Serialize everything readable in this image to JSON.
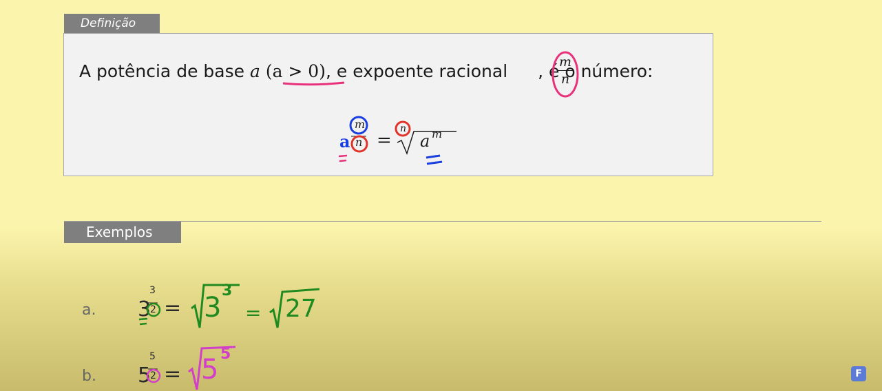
{
  "definition": {
    "tab_label": "Definição",
    "sentence_prefix": "A potência de base",
    "base_var": "a",
    "condition": "(a > 0)",
    "sentence_middle": ", e expoente racional",
    "exponent_num": "m",
    "exponent_den": "n",
    "sentence_suffix": ", é o número:",
    "formula": {
      "base": "a",
      "exp_num": "m",
      "exp_den": "n",
      "equals": "=",
      "root_index": "n",
      "radicand_base": "a",
      "radicand_exp": "m"
    }
  },
  "examples": {
    "tab_label": "Exemplos",
    "items": [
      {
        "label": "a.",
        "base": "3",
        "exp_num": "3",
        "exp_den": "2",
        "equals": "=",
        "radicand_base": "3",
        "radicand_exp": "3",
        "equals2": "=",
        "radicand2": "27"
      },
      {
        "label": "b.",
        "base": "5",
        "exp_num": "5",
        "exp_den": "2",
        "equals": "=",
        "radicand_base": "5",
        "radicand_exp": "5"
      }
    ]
  },
  "brand_icon": "brand-logo-icon",
  "colors": {
    "background": "#fbf4ac",
    "tab_gray": "#7f7f7f",
    "annotation_pink": "#e8317a",
    "annotation_blue": "#1a3fe0",
    "annotation_red": "#e0342a",
    "annotation_green": "#1f8a1f",
    "annotation_magenta": "#d23fc8"
  }
}
